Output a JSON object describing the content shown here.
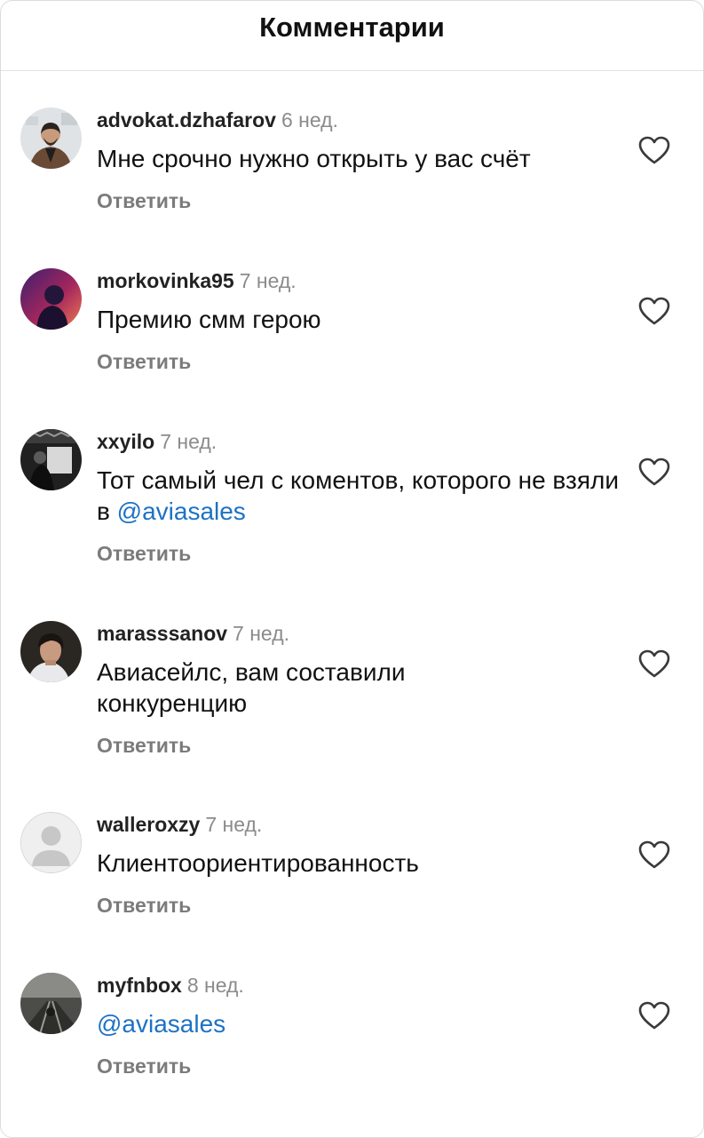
{
  "header": {
    "title": "Комментарии"
  },
  "comments": [
    {
      "username": "advokat.dzhafarov",
      "time": "6 нед.",
      "text": "Мне срочно нужно открыть у вас счёт",
      "reply_label": "Ответить"
    },
    {
      "username": "morkovinka95",
      "time": "7 нед.",
      "text": "Премию смм герою",
      "reply_label": "Ответить"
    },
    {
      "username": "xxyilo",
      "time": "7 нед.",
      "text": "Тот самый чел с коментов, которого не взяли в ",
      "mention": "@aviasales",
      "reply_label": "Ответить"
    },
    {
      "username": "marasssanov",
      "time": "7 нед.",
      "text": "Авиасейлс, вам составили конкуренцию",
      "reply_label": "Ответить"
    },
    {
      "username": "walleroxzy",
      "time": "7 нед.",
      "text": "Клиентоориентированность",
      "reply_label": "Ответить"
    },
    {
      "username": "myfnbox",
      "time": "8 нед.",
      "text": "",
      "mention": "@aviasales",
      "reply_label": "Ответить"
    }
  ],
  "colors": {
    "mention": "#1d72c4",
    "time": "#8b8b8b",
    "reply": "#7b7b7b"
  },
  "icons": {
    "like": "heart-outline-icon"
  }
}
